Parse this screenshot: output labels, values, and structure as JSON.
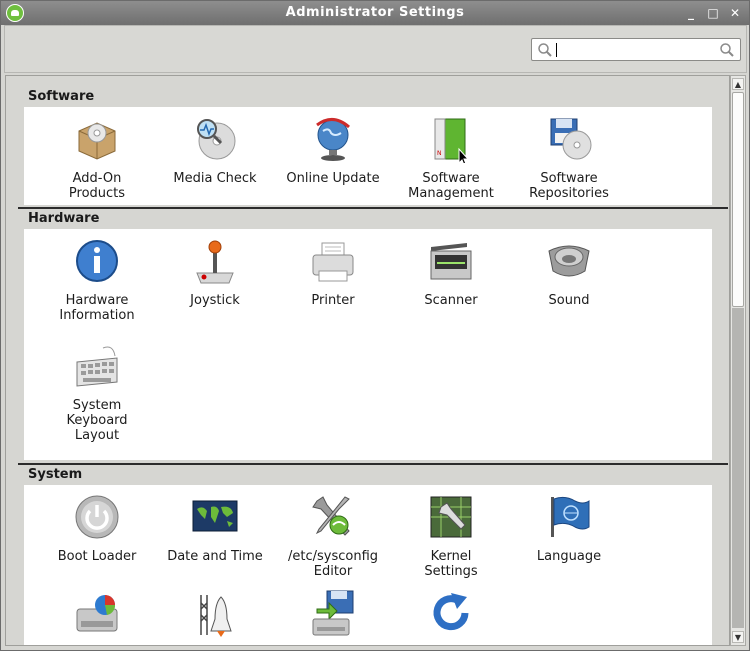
{
  "window": {
    "title": "Administrator Settings",
    "controls": [
      "_",
      "□",
      "✕"
    ]
  },
  "search": {
    "value": "",
    "placeholder": ""
  },
  "categories": [
    {
      "label": "Software",
      "items": [
        {
          "label": "Add-On\nProducts",
          "icon": "package-box-icon"
        },
        {
          "label": "Media Check",
          "icon": "media-check-icon"
        },
        {
          "label": "Online Update",
          "icon": "online-update-icon"
        },
        {
          "label": "Software\nManagement",
          "icon": "software-management-icon"
        },
        {
          "label": "Software\nRepositories",
          "icon": "software-repositories-icon"
        }
      ]
    },
    {
      "label": "Hardware",
      "items": [
        {
          "label": "Hardware\nInformation",
          "icon": "info-icon"
        },
        {
          "label": "Joystick",
          "icon": "joystick-icon"
        },
        {
          "label": "Printer",
          "icon": "printer-icon"
        },
        {
          "label": "Scanner",
          "icon": "scanner-icon"
        },
        {
          "label": "Sound",
          "icon": "sound-icon"
        },
        {
          "label": "System\nKeyboard\nLayout",
          "icon": "keyboard-icon"
        }
      ]
    },
    {
      "label": "System",
      "items": [
        {
          "label": "Boot Loader",
          "icon": "power-icon"
        },
        {
          "label": "Date and Time",
          "icon": "world-map-icon"
        },
        {
          "label": "/etc/sysconfig\nEditor",
          "icon": "sysconfig-editor-icon"
        },
        {
          "label": "Kernel\nSettings",
          "icon": "kernel-settings-icon"
        },
        {
          "label": "Language",
          "icon": "language-flag-icon"
        },
        {
          "label": "",
          "icon": "partitioner-icon"
        },
        {
          "label": "",
          "icon": "services-icon"
        },
        {
          "label": "",
          "icon": "backup-icon"
        },
        {
          "label": "",
          "icon": "refresh-icon"
        }
      ]
    }
  ],
  "colors": {
    "titlebar": "#7f7f7f",
    "panel": "#ffffff",
    "accent": "#6fbf3f"
  }
}
